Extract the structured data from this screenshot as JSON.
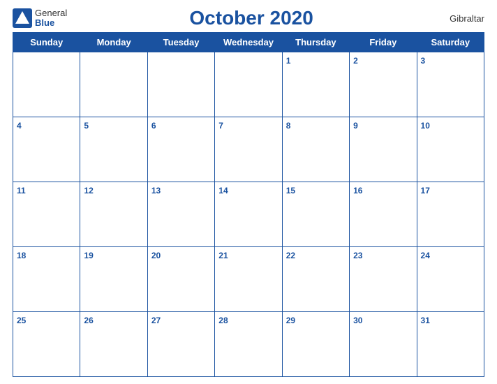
{
  "header": {
    "logo_general": "General",
    "logo_blue": "Blue",
    "title": "October 2020",
    "region": "Gibraltar"
  },
  "days_of_week": [
    "Sunday",
    "Monday",
    "Tuesday",
    "Wednesday",
    "Thursday",
    "Friday",
    "Saturday"
  ],
  "weeks": [
    [
      "",
      "",
      "",
      "",
      "1",
      "2",
      "3"
    ],
    [
      "4",
      "5",
      "6",
      "7",
      "8",
      "9",
      "10"
    ],
    [
      "11",
      "12",
      "13",
      "14",
      "15",
      "16",
      "17"
    ],
    [
      "18",
      "19",
      "20",
      "21",
      "22",
      "23",
      "24"
    ],
    [
      "25",
      "26",
      "27",
      "28",
      "29",
      "30",
      "31"
    ]
  ]
}
